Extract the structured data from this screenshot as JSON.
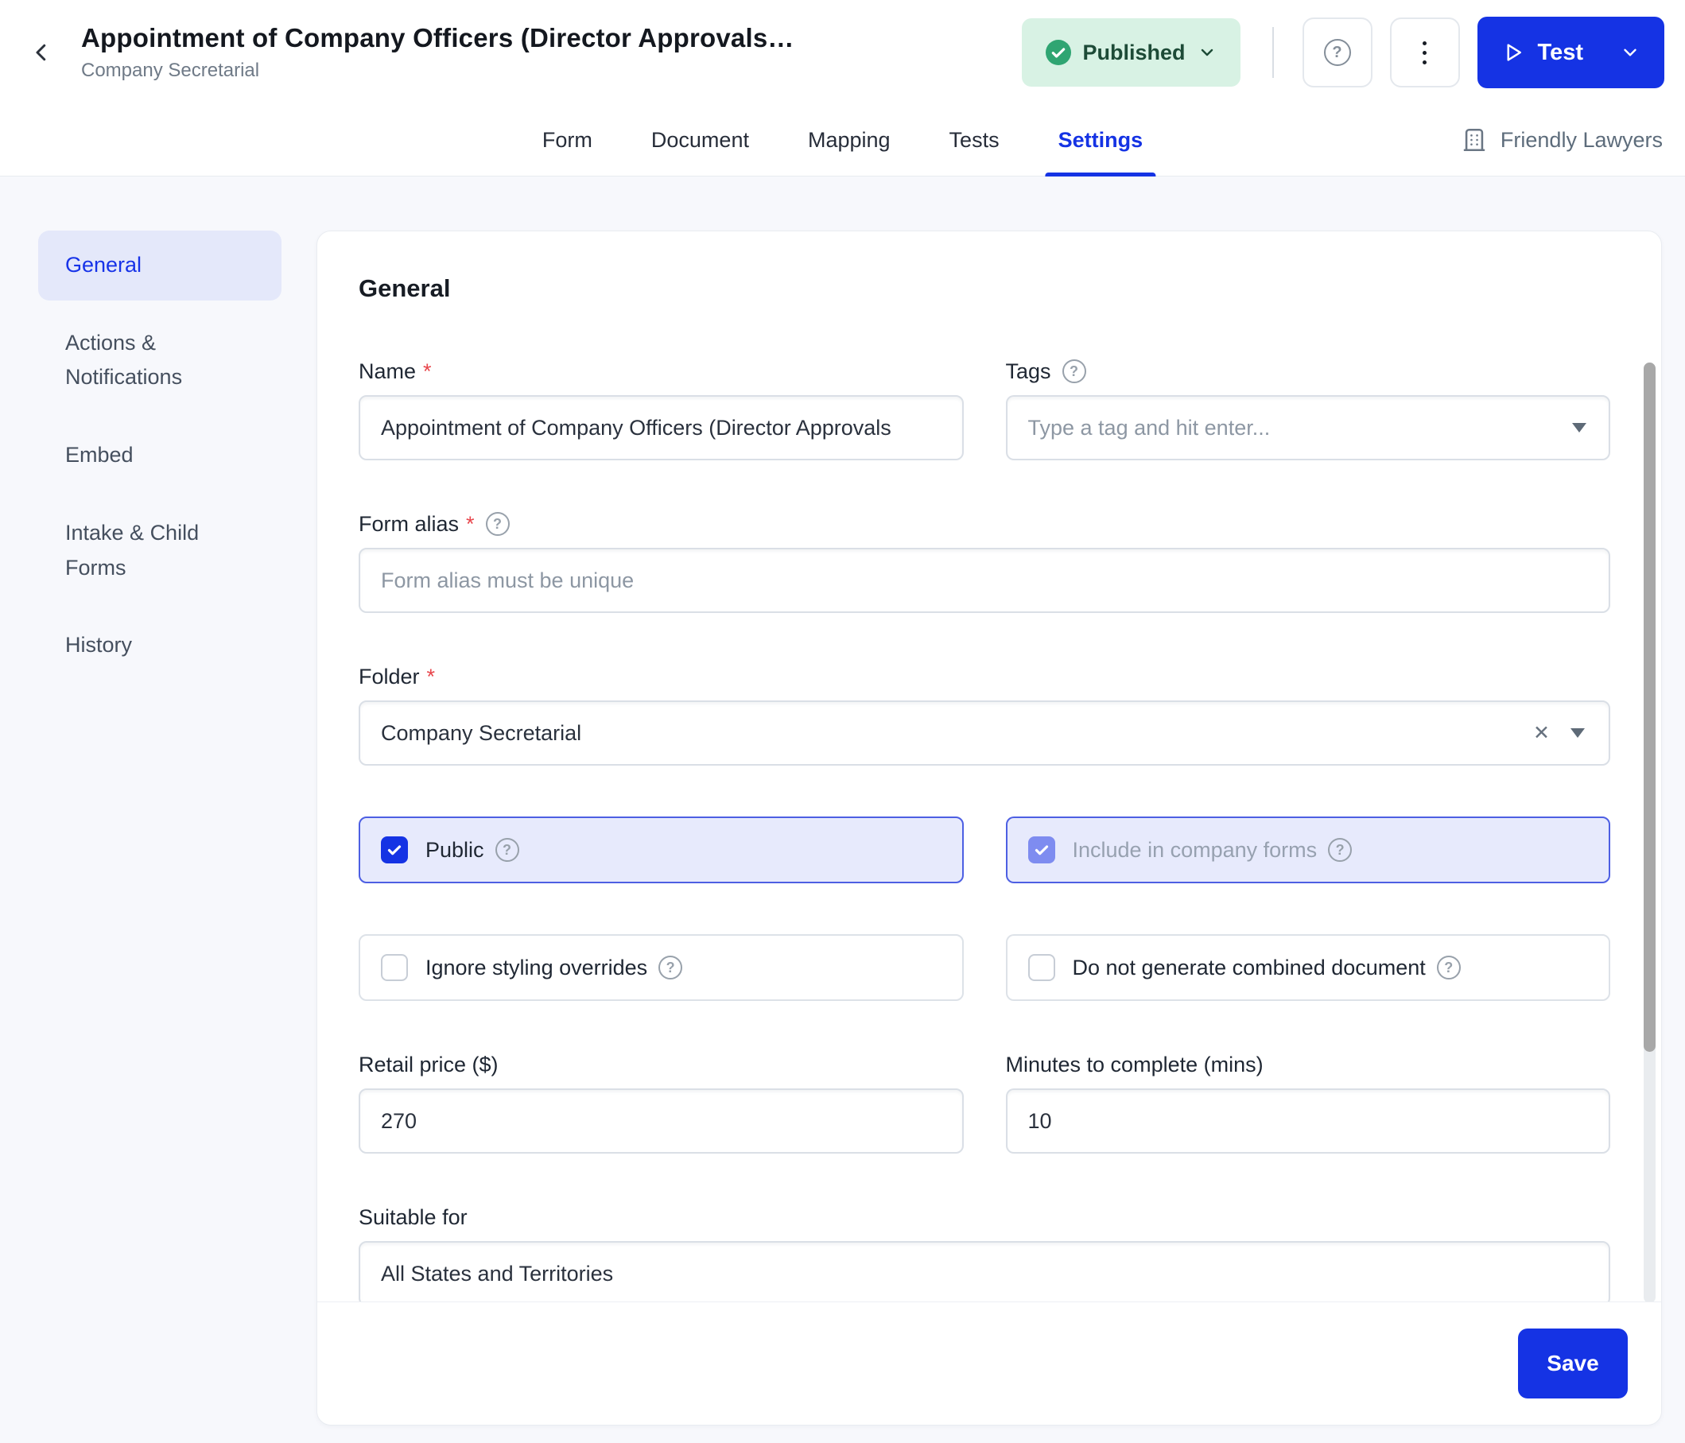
{
  "colors": {
    "accent_blue": "#1533e4",
    "active_sidebar_blue": "#1733e8",
    "published_bg": "#d8f2e4",
    "published_text": "#1d4b37",
    "published_check_green": "#2fa572",
    "page_bg": "#f7f8fc",
    "checked_card_bg": "#e7eafc",
    "checked_card_border": "#4d5fe3",
    "disabled_check_fill": "#7e8cf0"
  },
  "header": {
    "back_icon": "chevron-left",
    "title": "Appointment of Company Officers (Director Approvals…",
    "subtitle": "Company Secretarial",
    "status_badge": {
      "label": "Published",
      "icon": "check-circle",
      "chevron_icon": "chevron-down"
    },
    "help_button_icon": "question-mark-circle",
    "more_button_icon": "kebab-vertical-dots",
    "test_button": {
      "label": "Test",
      "icon": "play-outline",
      "chevron_icon": "chevron-down"
    },
    "tabs": [
      {
        "label": "Form",
        "active": false
      },
      {
        "label": "Document",
        "active": false
      },
      {
        "label": "Mapping",
        "active": false
      },
      {
        "label": "Tests",
        "active": false
      },
      {
        "label": "Settings",
        "active": true
      }
    ],
    "workspace": {
      "label": "Friendly Lawyers",
      "icon": "building"
    }
  },
  "sidebar": {
    "items": [
      {
        "label": "General",
        "active": true
      },
      {
        "label": "Actions & Notifications",
        "active": false
      },
      {
        "label": "Embed",
        "active": false
      },
      {
        "label": "Intake & Child Forms",
        "active": false
      },
      {
        "label": "History",
        "active": false
      }
    ]
  },
  "main": {
    "heading": "General",
    "name_field": {
      "label": "Name",
      "required": "*",
      "value": "Appointment of Company Officers (Director Approvals"
    },
    "tags_field": {
      "label": "Tags",
      "placeholder": "Type a tag and hit enter...",
      "help_icon": "question-mark-circle",
      "dropdown_icon": "caret-down"
    },
    "form_alias_field": {
      "label": "Form alias",
      "required": "*",
      "placeholder": "Form alias must be unique",
      "help_icon": "question-mark-circle"
    },
    "folder_field": {
      "label": "Folder",
      "required": "*",
      "value": "Company Secretarial",
      "clear_icon": "x-clear",
      "dropdown_icon": "caret-down"
    },
    "public_checkbox": {
      "label": "Public",
      "checked": true,
      "help_icon": "question-mark-circle"
    },
    "company_forms_checkbox": {
      "label": "Include in company forms",
      "checked": true,
      "disabled": true,
      "help_icon": "question-mark-circle"
    },
    "styling_checkbox": {
      "label": "Ignore styling overrides",
      "checked": false,
      "help_icon": "question-mark-circle"
    },
    "combined_doc_checkbox": {
      "label": "Do not generate combined document",
      "checked": false,
      "help_icon": "question-mark-circle"
    },
    "retail_price_field": {
      "label": "Retail price ($)",
      "value": "270"
    },
    "minutes_field": {
      "label": "Minutes to complete (mins)",
      "value": "10"
    },
    "suitable_for_field": {
      "label": "Suitable for",
      "value": "All States and Territories"
    },
    "save_button": "Save"
  }
}
